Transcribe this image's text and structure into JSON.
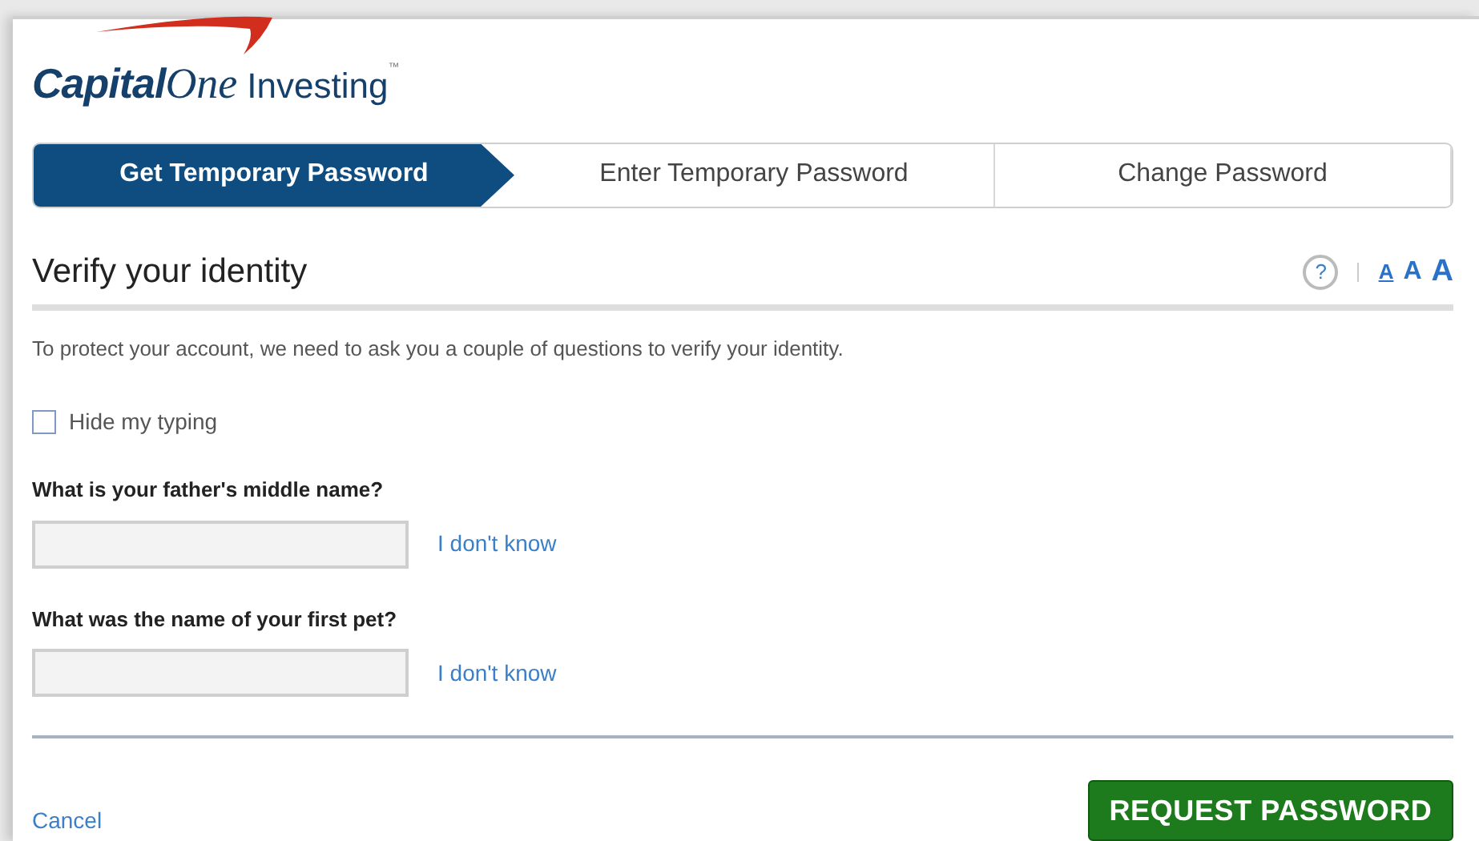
{
  "logo": {
    "brand_first": "Capital",
    "brand_second": "One",
    "product": "Investing",
    "trademark": "™"
  },
  "steps": [
    {
      "label": "Get Temporary Password",
      "selected": true
    },
    {
      "label": "Enter Temporary Password",
      "selected": false
    },
    {
      "label": "Change Password",
      "selected": false
    }
  ],
  "heading": "Verify your identity",
  "help": "?",
  "text_sizes": [
    {
      "label": "A",
      "selected": true
    },
    {
      "label": "A",
      "selected": false
    },
    {
      "label": "A",
      "selected": false
    }
  ],
  "intro": "To protect your account, we need to ask you a couple of questions to verify your identity.",
  "hide_typing": {
    "label": "Hide my typing",
    "checked": false
  },
  "questions": [
    {
      "label": "What is your father's middle name?",
      "link": "I don't know"
    },
    {
      "label": "What was the name of your first pet?",
      "link": "I don't know"
    }
  ],
  "cancel": "Cancel",
  "submit": "REQUEST PASSWORD"
}
